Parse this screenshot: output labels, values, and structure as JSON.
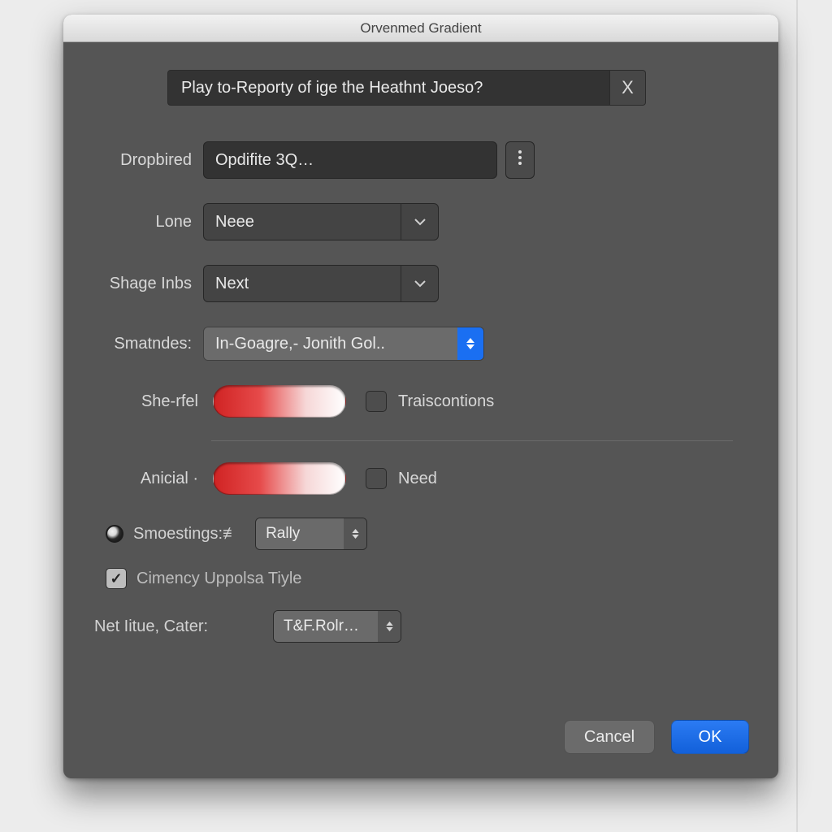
{
  "window": {
    "title": "Orvenmed Gradient"
  },
  "header": {
    "text": "Play to-Reporty of ige the Heathnt Joeso?",
    "close_glyph": "X"
  },
  "rows": {
    "dropbired": {
      "label": "Dropbired",
      "value": "Opdifite 3Q…"
    },
    "lone": {
      "label": "Lone",
      "value": "Neee"
    },
    "shage": {
      "label": "Shage Inbs",
      "value": "Next"
    },
    "smatndes": {
      "label": "Smatndes:",
      "value": "In-Goagre,- Jonith Gol.."
    }
  },
  "swatches": {
    "sherfel": {
      "label": "She-rfel",
      "checkbox_label": "Traiscontions"
    },
    "anicial": {
      "label": "Anicial ·",
      "checkbox_label": "Need"
    }
  },
  "lower": {
    "smoestings": {
      "label": "Smoestings:≢",
      "value": "Rally"
    },
    "cimency": {
      "label": "Cimency Uppolsa Tiyle"
    },
    "netlitue": {
      "label": "Net Iitue, Cater:",
      "value": "T&F.Rolr…"
    }
  },
  "footer": {
    "cancel": "Cancel",
    "ok": "OK"
  }
}
